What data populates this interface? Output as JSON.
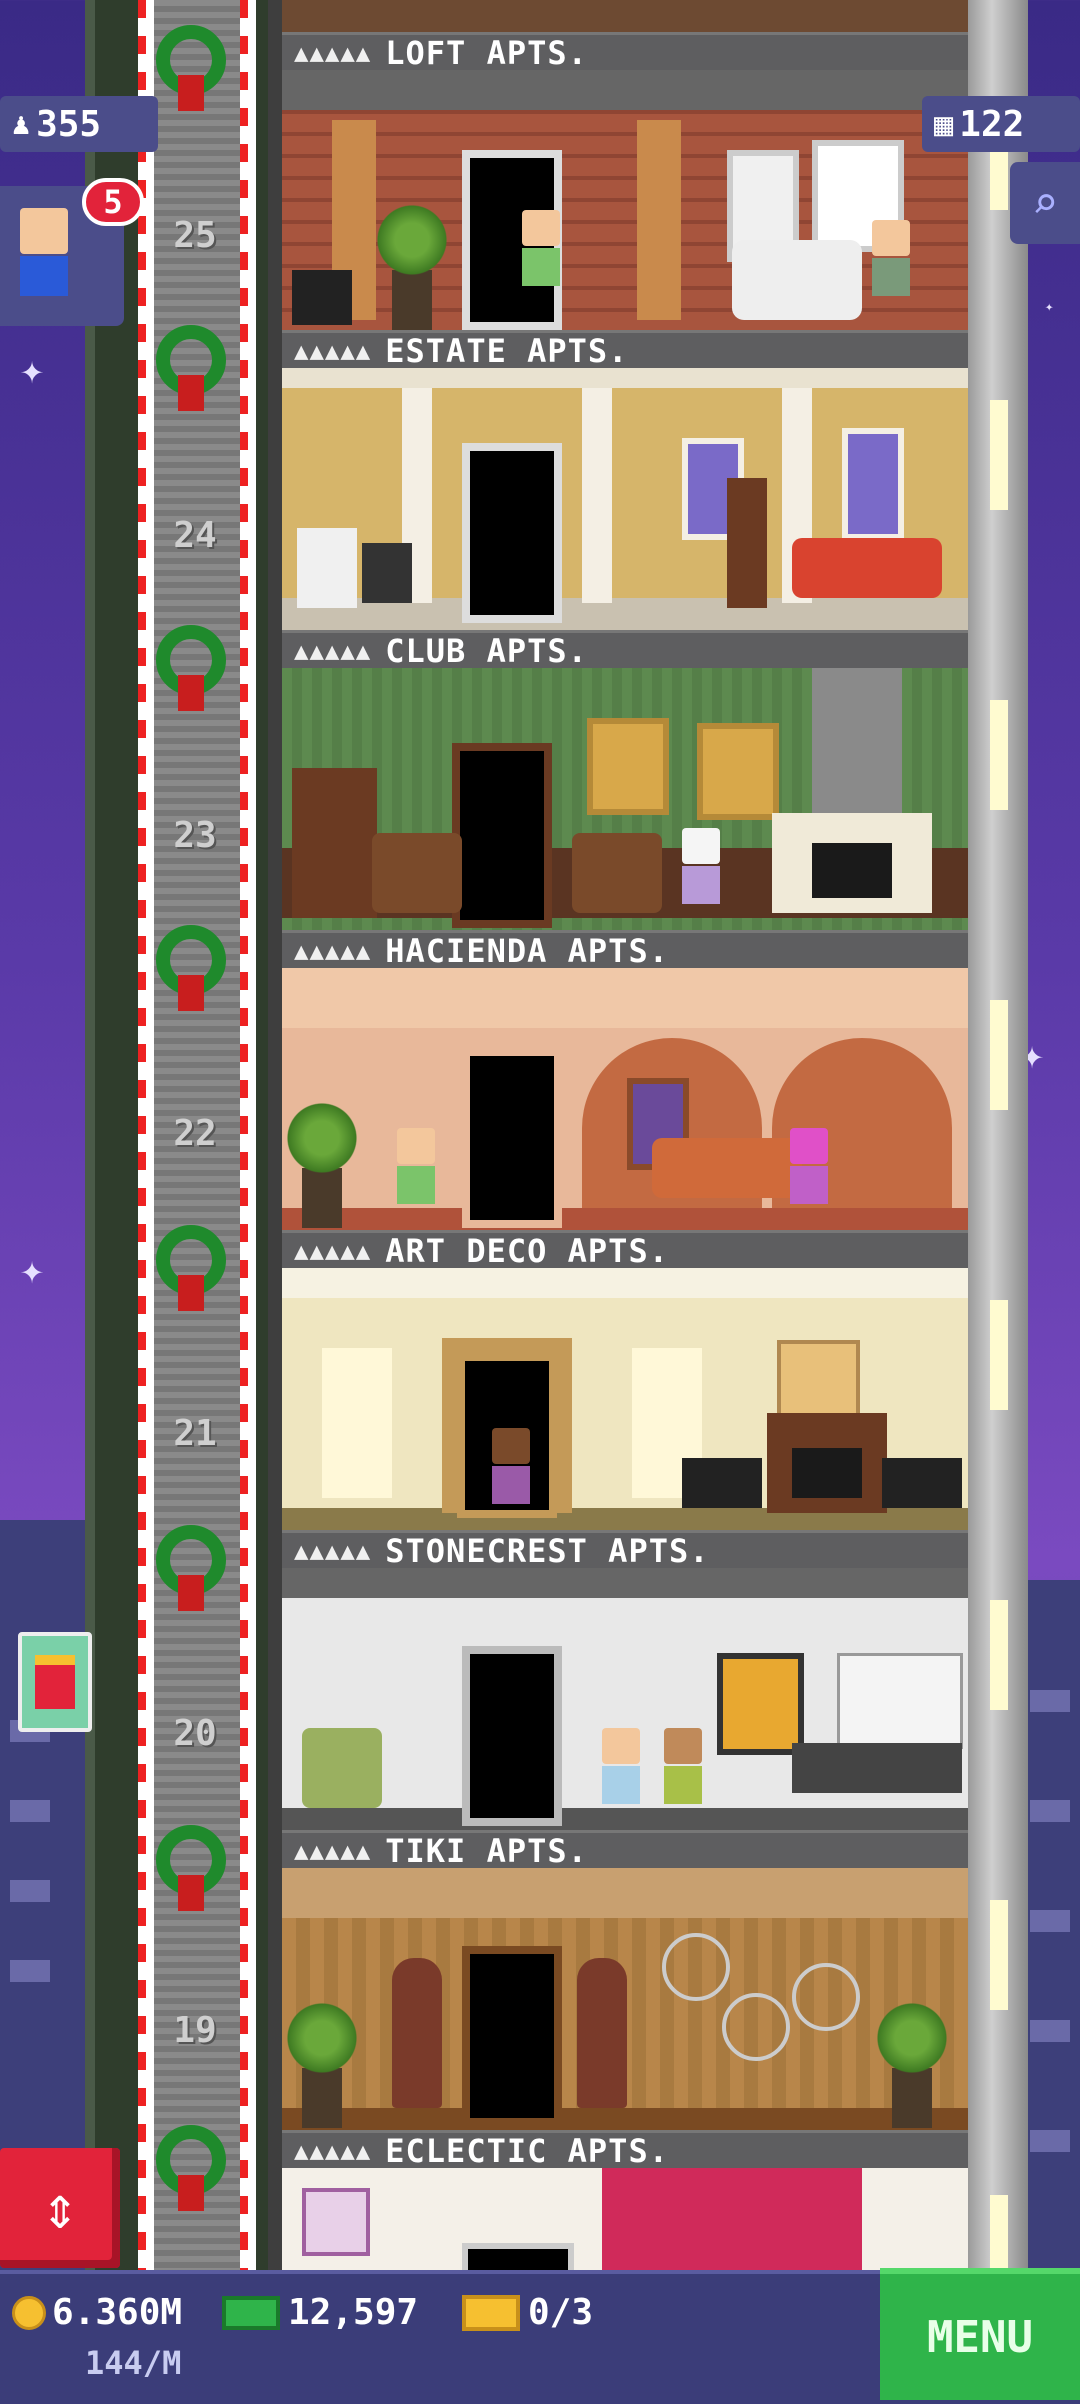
{
  "hud": {
    "population": "355",
    "floors": "122",
    "notif_count": "5"
  },
  "floors": [
    {
      "label": "LOFT APTS.",
      "stars": "▲▲▲▲▲",
      "number": "25"
    },
    {
      "label": "ESTATE APTS.",
      "stars": "▲▲▲▲▲",
      "number": "24"
    },
    {
      "label": "CLUB APTS.",
      "stars": "▲▲▲▲▲",
      "number": "23"
    },
    {
      "label": "HACIENDA APTS.",
      "stars": "▲▲▲▲▲",
      "number": "22"
    },
    {
      "label": "ART DECO APTS.",
      "stars": "▲▲▲▲▲",
      "number": "21"
    },
    {
      "label": "STONECREST APTS.",
      "stars": "▲▲▲▲▲",
      "number": "20"
    },
    {
      "label": "TIKI APTS.",
      "stars": "▲▲▲▲▲",
      "number": "19"
    },
    {
      "label": "ECLECTIC APTS.",
      "stars": "▲▲▲▲▲",
      "number": ""
    }
  ],
  "bottom": {
    "coins": "6.360M",
    "coins_rate": "144/M",
    "bux": "12,597",
    "tickets": "0/3",
    "menu": "MENU"
  },
  "colors": {
    "accent_green": "#2fb44a",
    "elevator_red": "#e2233a",
    "sky_purple": "#5a3aa8"
  }
}
